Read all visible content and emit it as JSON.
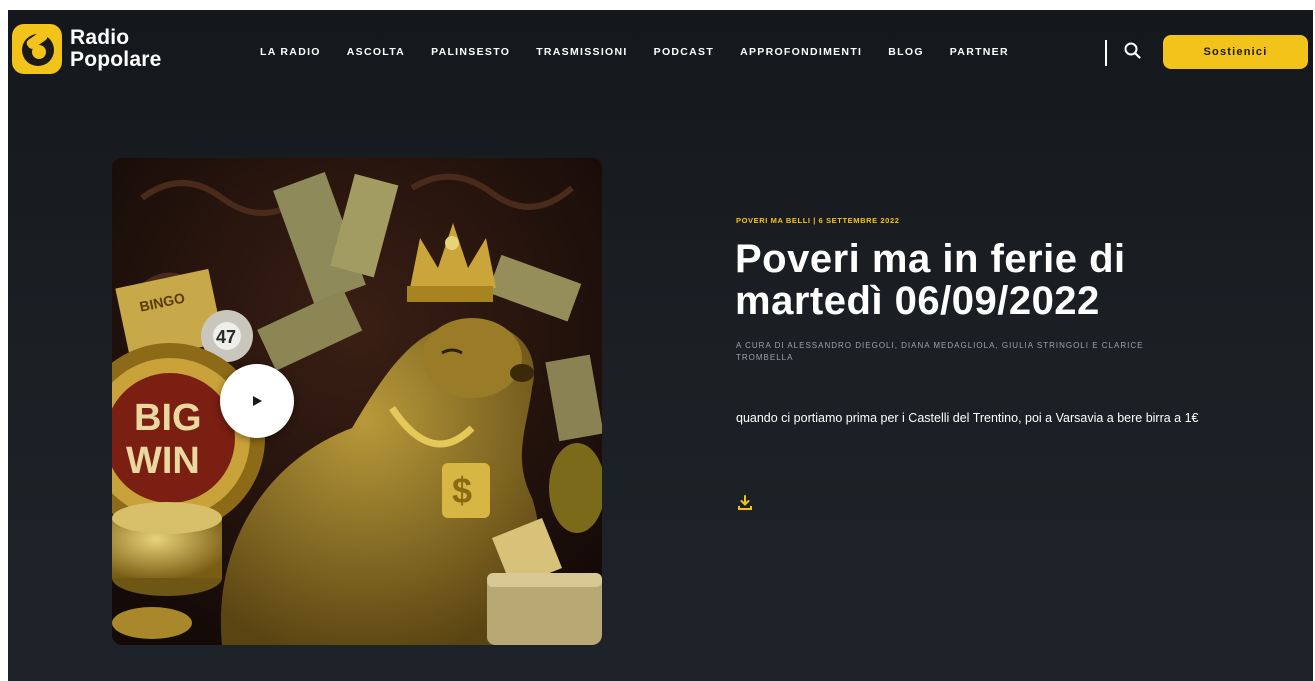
{
  "brand": {
    "name_line1": "Radio",
    "name_line2": "Popolare",
    "accent": "#f2c318"
  },
  "nav": {
    "items": [
      "LA RADIO",
      "ASCOLTA",
      "PALINSESTO",
      "TRASMISSIONI",
      "PODCAST",
      "APPROFONDIMENTI",
      "BLOG",
      "PARTNER"
    ],
    "search_icon": "search-icon",
    "support_label": "Sostienici"
  },
  "episode": {
    "kicker": "POVERI MA BELLI | 6 SETTEMBRE 2022",
    "title": "Poveri ma in ferie di martedì 06/09/2022",
    "credits": "A CURA DI ALESSANDRO DIEGOLI, DIANA MEDAGLIOLA, GIULIA STRINGOLI E CLARICE TROMBELLA",
    "description": "quando ci portiamo prima per i Castelli del Trentino, poi a Varsavia a bere birra a 1€",
    "artwork_text": {
      "big": "BIG",
      "win": "WIN",
      "bingo": "BINGO",
      "ball": "47"
    },
    "play_icon": "play-icon",
    "download_icon": "download-icon"
  }
}
